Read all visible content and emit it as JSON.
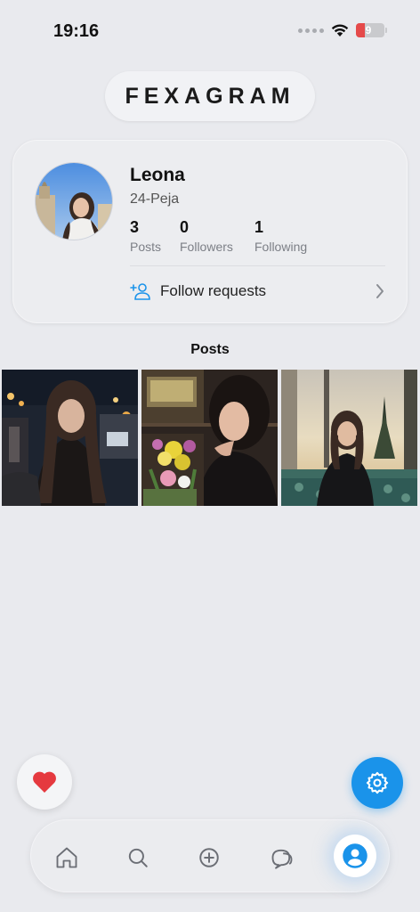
{
  "status_bar": {
    "time": "19:16",
    "battery": "9"
  },
  "app": {
    "logo": "FEXAGRAM"
  },
  "profile": {
    "name": "Leona",
    "subtitle": "24-Peja",
    "stats": [
      {
        "value": "3",
        "label": "Posts"
      },
      {
        "value": "0",
        "label": "Followers"
      },
      {
        "value": "1",
        "label": "Following"
      }
    ],
    "follow_requests_label": "Follow requests"
  },
  "posts": {
    "heading": "Posts",
    "items": [
      "post-photo-1",
      "post-photo-2",
      "post-photo-3"
    ]
  },
  "nav": {
    "items": [
      "home-icon",
      "search-icon",
      "add-icon",
      "chat-icon",
      "profile-icon"
    ],
    "active": "profile-icon"
  },
  "colors": {
    "accent": "#1a93ea",
    "heart": "#e5393f",
    "background": "#e9eaee"
  }
}
